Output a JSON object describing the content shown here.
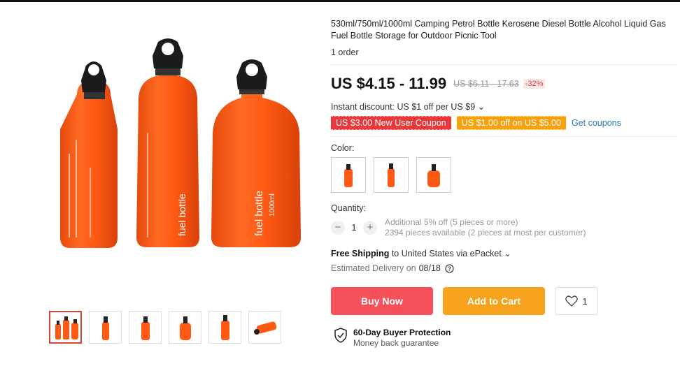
{
  "product": {
    "title": "530ml/750ml/1000ml Camping Petrol Bottle Kerosene Diesel Bottle Alcohol Liquid Gas Fuel Bottle Storage for Outdoor Picnic Tool",
    "orders": "1 order"
  },
  "price": {
    "current": "US $4.15 - 11.99",
    "original": "US $6.11 - 17.63",
    "discount": "-32%"
  },
  "instant_discount": "Instant discount: US $1 off per US $9 ⌄",
  "coupons": {
    "new_user": "US $3.00 New User Coupon",
    "store": "US $1.00 off on US $5.00",
    "get_link": "Get coupons"
  },
  "color": {
    "label": "Color:"
  },
  "quantity": {
    "label": "Quantity:",
    "value": "1",
    "minus": "−",
    "plus": "+",
    "note1": "Additional 5% off (5 pieces or more)",
    "note2": "2394 pieces available (2 pieces at most per customer)"
  },
  "shipping": {
    "free": "Free Shipping",
    "rest": " to United States via ePacket ⌄"
  },
  "delivery": {
    "label": "Estimated Delivery on",
    "date": "08/18"
  },
  "actions": {
    "buy_now": "Buy Now",
    "add_to_cart": "Add to Cart",
    "wishlist_count": "1"
  },
  "protection": {
    "title": "60-Day Buyer Protection",
    "subtitle": "Money back guarantee"
  },
  "bottle_label": {
    "brand_text": "fuel bottle",
    "volume_text": "1000ml"
  },
  "colors": {
    "bottle": "#ff5a14",
    "cap": "#1b1b1b",
    "price_red": "#e4393c",
    "coupon_red": "#e8383c",
    "coupon_orange": "#f6a10e",
    "buy_now": "#f5515b",
    "add_to_cart": "#f7a21c",
    "link_blue": "#2a7ab8"
  }
}
